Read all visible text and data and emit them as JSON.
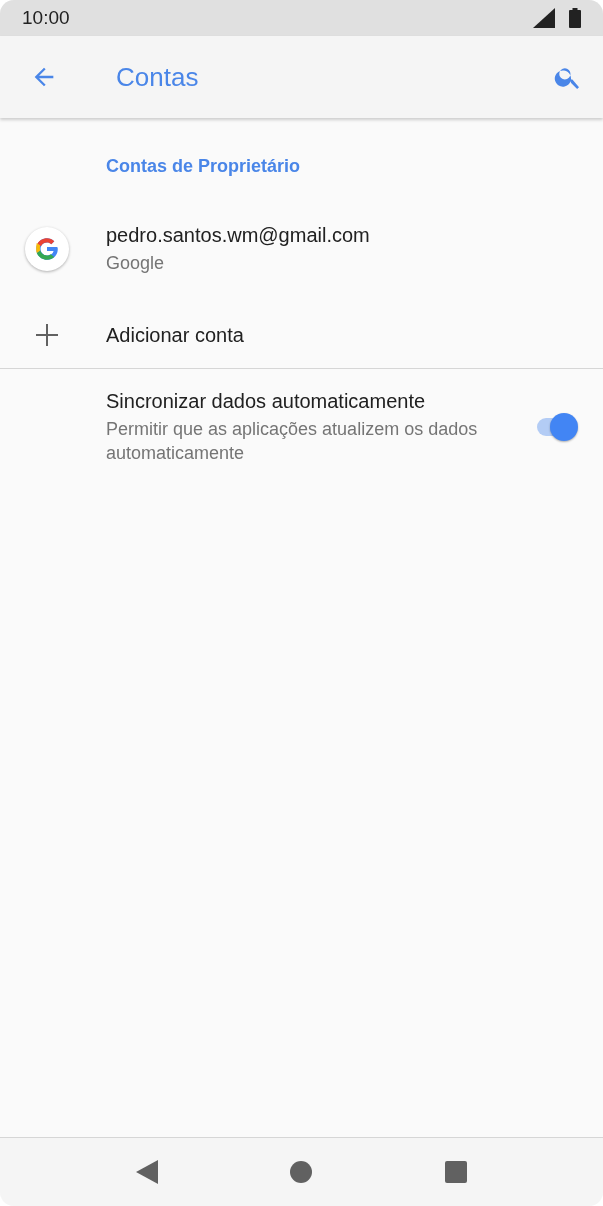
{
  "status_bar": {
    "time": "10:00"
  },
  "app_bar": {
    "title": "Contas"
  },
  "section": {
    "header": "Contas de Proprietário"
  },
  "accounts": [
    {
      "email": "pedro.santos.wm@gmail.com",
      "provider": "Google"
    }
  ],
  "add_account": {
    "label": "Adicionar conta"
  },
  "settings": [
    {
      "kind": "switch",
      "title": "Sincronizar dados automaticamente",
      "summary": "Permitir que as aplicações atualizem os dados automaticamente",
      "on": true
    }
  ]
}
